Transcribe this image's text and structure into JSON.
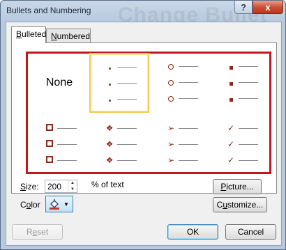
{
  "window": {
    "title": "Bullets and Numbering",
    "background_text": "Change Bullet",
    "help_label": "?",
    "close_label": "x"
  },
  "tabs": [
    {
      "label_underlined": "B",
      "label_rest": "ulleted",
      "active": true
    },
    {
      "label_underlined": "N",
      "label_rest": "umbered",
      "active": false
    }
  ],
  "gallery": {
    "none_label": "None",
    "selected_index": 1,
    "border_color": "#c4161c",
    "bullet_color": "#8b2a1b",
    "styles": [
      {
        "name": "none"
      },
      {
        "name": "small-dot",
        "icon": "small-dot-bullet-icon"
      },
      {
        "name": "hollow-circle",
        "icon": "hollow-circle-bullet-icon"
      },
      {
        "name": "filled-square",
        "icon": "filled-square-bullet-icon"
      },
      {
        "name": "hollow-square",
        "icon": "hollow-square-bullet-icon"
      },
      {
        "name": "four-diamond",
        "icon": "four-diamond-bullet-icon",
        "glyph": "❖"
      },
      {
        "name": "arrowhead",
        "icon": "arrowhead-bullet-icon",
        "glyph": "➢"
      },
      {
        "name": "checkmark",
        "icon": "checkmark-bullet-icon",
        "glyph": "✓"
      }
    ]
  },
  "size": {
    "label_underlined": "S",
    "label_rest": "ize:",
    "value": "200",
    "suffix": "% of text"
  },
  "color": {
    "label_pre": "C",
    "label_underlined": "o",
    "label_rest": "lor",
    "current": "#c0392b"
  },
  "buttons": {
    "picture": {
      "underlined": "P",
      "rest": "icture..."
    },
    "customize": {
      "pre": "C",
      "underlined": "u",
      "rest": "stomize..."
    },
    "reset": {
      "pre": "R",
      "underlined": "e",
      "rest": "set"
    },
    "ok": "OK",
    "cancel": "Cancel"
  }
}
